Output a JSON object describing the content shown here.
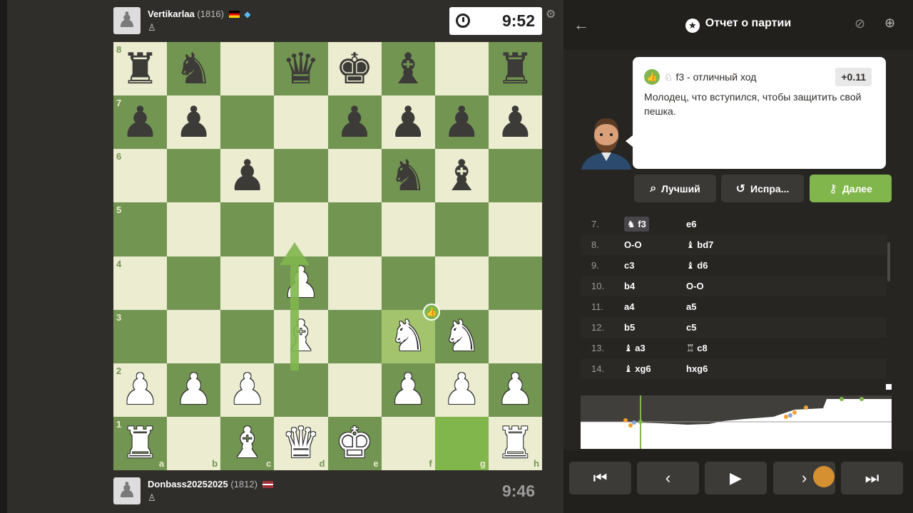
{
  "top_player": {
    "name": "Vertikarlaa",
    "rating": "(1816)",
    "clock": "9:52"
  },
  "bottom_player": {
    "name": "Donbass20252025",
    "rating": "(1812)",
    "clock": "9:46"
  },
  "board": {
    "ranks": [
      "8",
      "7",
      "6",
      "5",
      "4",
      "3",
      "2",
      "1"
    ],
    "files": [
      "a",
      "b",
      "c",
      "d",
      "e",
      "f",
      "g",
      "h"
    ],
    "pieces": [
      [
        "bR",
        "bN",
        "",
        "bQ",
        "bK",
        "bB",
        "",
        "bR"
      ],
      [
        "bP",
        "bP",
        "",
        "",
        "bP",
        "bP",
        "bP",
        "bP"
      ],
      [
        "",
        "",
        "bP",
        "",
        "",
        "bN",
        "bB",
        ""
      ],
      [
        "",
        "",
        "",
        "",
        "",
        "",
        "",
        ""
      ],
      [
        "",
        "",
        "",
        "wP",
        "",
        "",
        "",
        ""
      ],
      [
        "",
        "",
        "",
        "wB",
        "",
        "wN",
        "wN",
        ""
      ],
      [
        "wP",
        "wP",
        "wP",
        "",
        "",
        "wP",
        "wP",
        "wP"
      ],
      [
        "wR",
        "",
        "wB",
        "wQ",
        "wK",
        "",
        "",
        "wR"
      ]
    ]
  },
  "review": {
    "title": "Отчет о партии",
    "move_label": "f3",
    "move_quality": " - отличный ход",
    "eval": "+0.11",
    "comment": "Молодец, что вступился, чтобы защитить свой пешка."
  },
  "buttons": {
    "best": "Лучший",
    "retry": "Испра...",
    "next": "Далее"
  },
  "moves": [
    {
      "n": "7.",
      "w": "f3",
      "b": "e6"
    },
    {
      "n": "8.",
      "w": "O-O",
      "b": "bd7"
    },
    {
      "n": "9.",
      "w": "c3",
      "b": "d6"
    },
    {
      "n": "10.",
      "w": "b4",
      "b": "O-O"
    },
    {
      "n": "11.",
      "w": "a4",
      "b": "a5"
    },
    {
      "n": "12.",
      "w": "b5",
      "b": "c5"
    },
    {
      "n": "13.",
      "w": "a3",
      "b": "c8"
    },
    {
      "n": "14.",
      "w": "xg6",
      "b": "hxg6"
    }
  ],
  "move_icons": {
    "w0": "♞",
    "b1": "♝",
    "b2": "♝",
    "w6": "♝",
    "b6": "♖",
    "w7": "♝"
  },
  "colors": {
    "light": "#ebecd0",
    "dark": "#739552",
    "accent": "#81b64c"
  }
}
